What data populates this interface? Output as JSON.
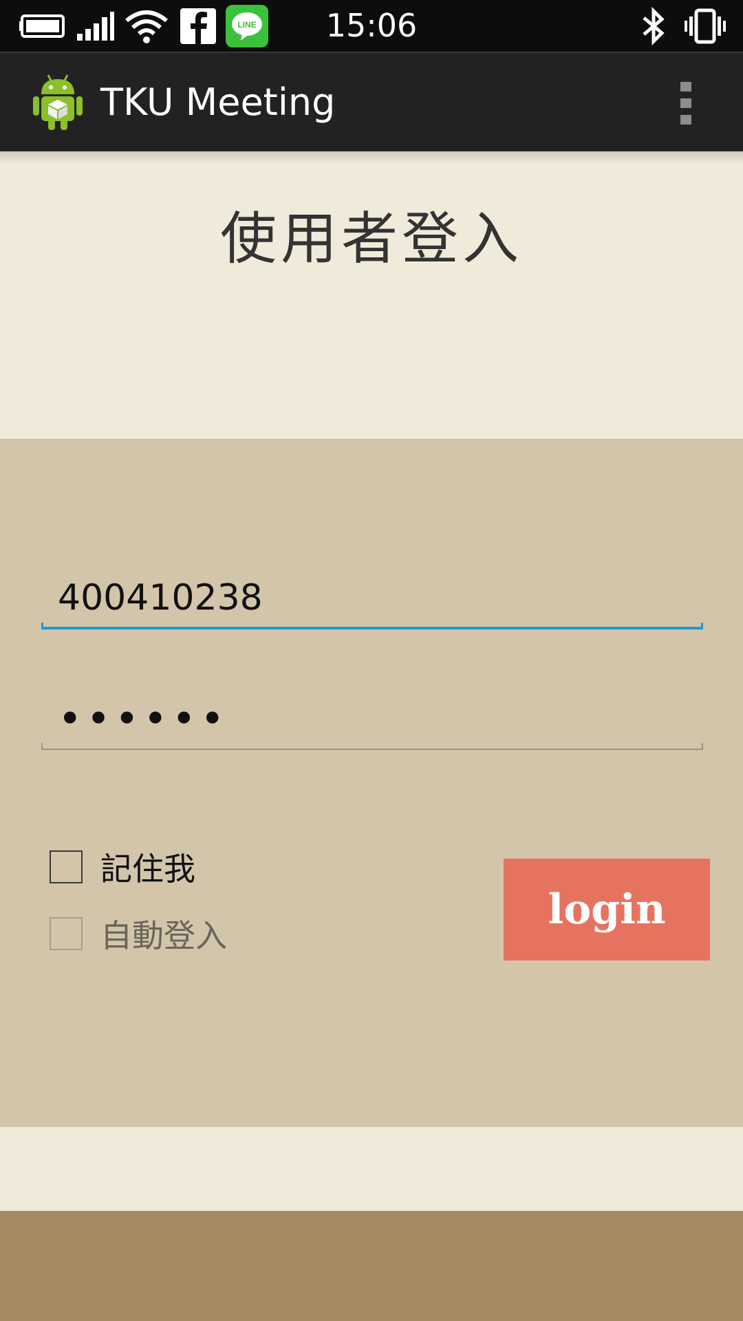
{
  "status_bar": {
    "time": "15:06",
    "left_icons": [
      "battery-icon",
      "signal-icon",
      "wifi-icon",
      "facebook-icon",
      "line-icon"
    ],
    "right_icons": [
      "bluetooth-icon",
      "vibrate-icon"
    ],
    "line_label": "LINE"
  },
  "action_bar": {
    "app_icon": "android-icon",
    "title": "TKU Meeting",
    "overflow_icon": "overflow-menu-icon"
  },
  "page": {
    "heading": "使用者登入"
  },
  "form": {
    "username_value": "400410238",
    "password_mask": "••••••",
    "remember_label": "記住我",
    "remember_checked": false,
    "autologin_label": "自動登入",
    "autologin_checked": false,
    "autologin_enabled": false,
    "login_label": "login"
  },
  "colors": {
    "accent_underline": "#1a9ad6",
    "login_button": "#e6735f",
    "panel": "#d3c5aa",
    "background": "#f0eadb",
    "footer": "#a38b5f",
    "action_bar": "#222222"
  }
}
